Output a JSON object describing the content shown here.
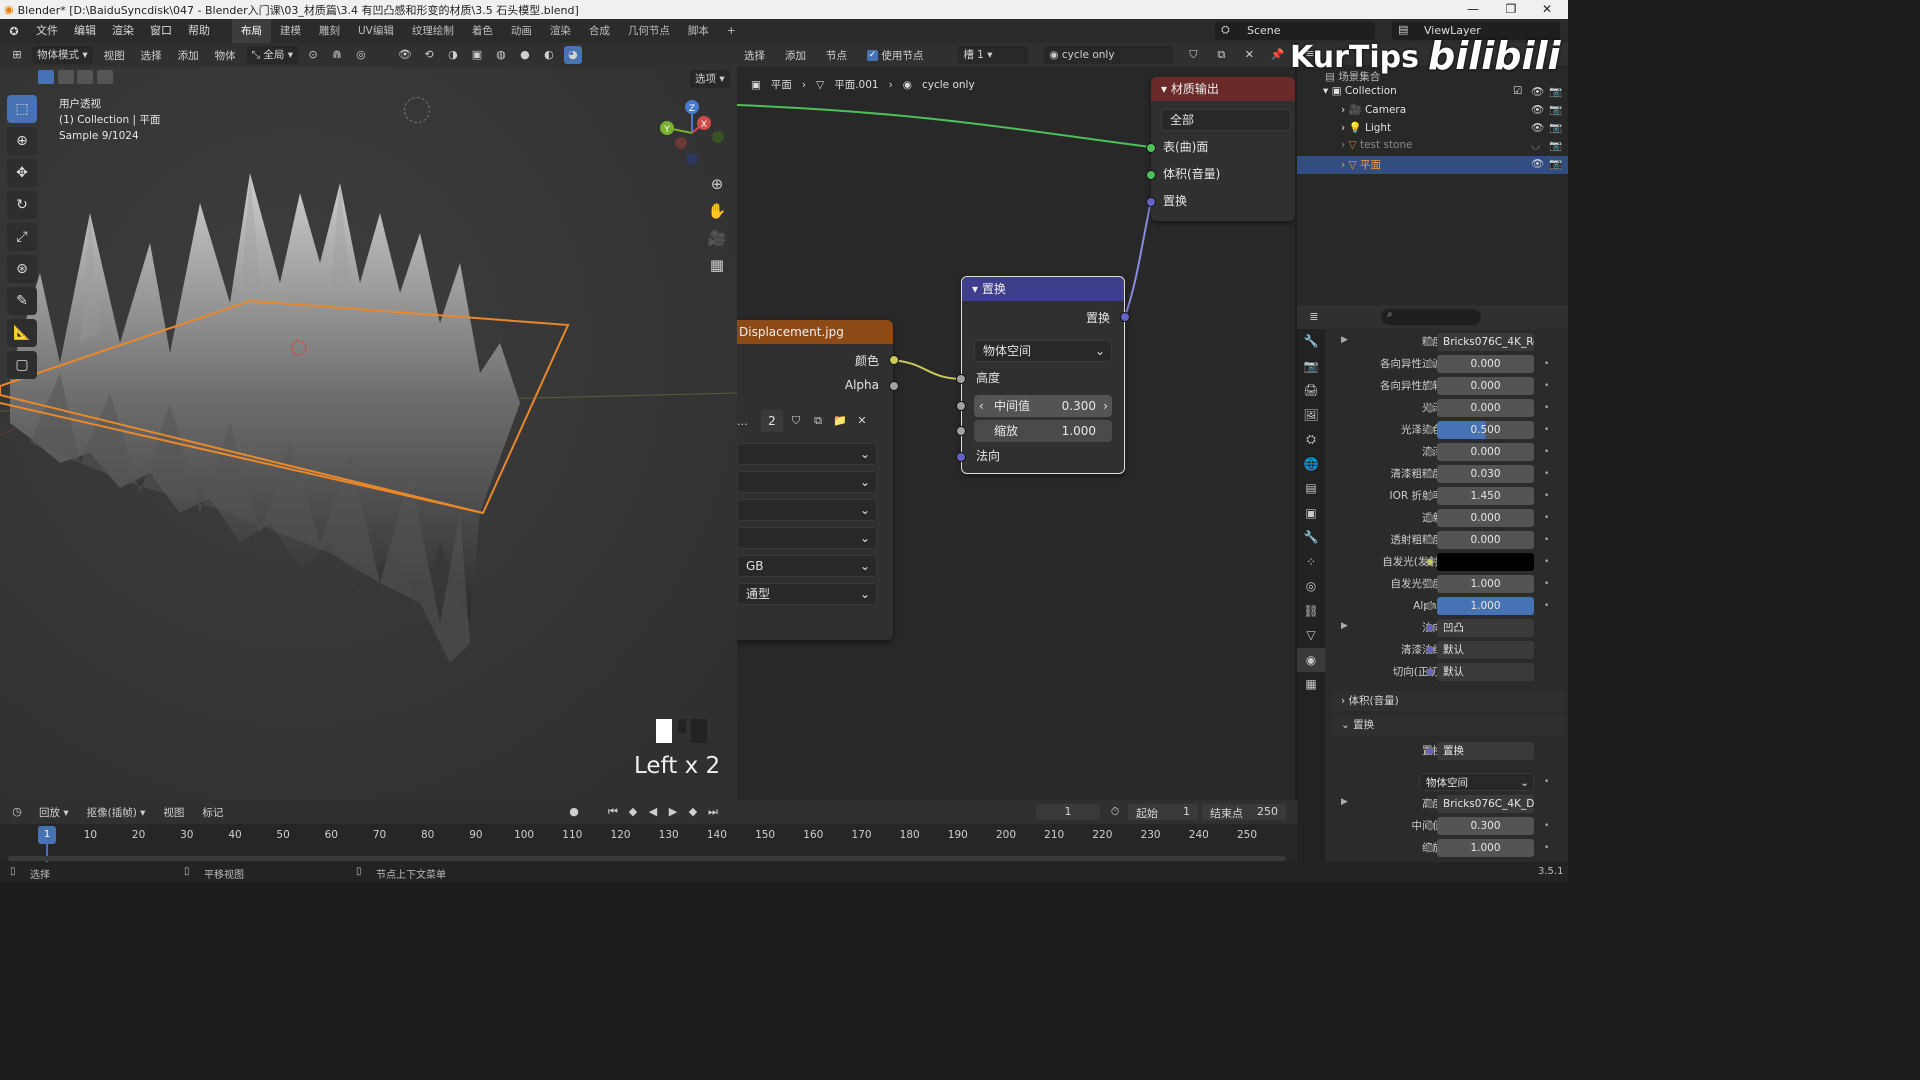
{
  "titlebar": {
    "title": "Blender* [D:\\BaiduSyncdisk\\047 - Blender入门课\\03_材质篇\\3.4 有凹凸感和形变的材质\\3.5 石头模型.blend]",
    "minimize": "—",
    "maximize": "❐",
    "close": "✕"
  },
  "menubar": {
    "menus": [
      "文件",
      "编辑",
      "渲染",
      "窗口",
      "帮助"
    ],
    "workspaces": [
      "布局",
      "建模",
      "雕刻",
      "UV编辑",
      "纹理绘制",
      "着色",
      "动画",
      "渲染",
      "合成",
      "几何节点",
      "脚本"
    ],
    "active_workspace": "布局",
    "add_tab": "+",
    "scene": "Scene",
    "view_layer": "ViewLayer"
  },
  "watermark": {
    "left": "KurTips",
    "right": "bilibili"
  },
  "viewport": {
    "mode": "物体模式",
    "menus": [
      "视图",
      "选择",
      "添加",
      "物体"
    ],
    "transform_orientation": "全局",
    "options": "选项",
    "info_line1": "用户透视",
    "info_line2": "(1) Collection | 平面",
    "info_line3": "Sample 9/1024",
    "gizmo": {
      "x": "X",
      "y": "Y",
      "z": "Z"
    },
    "key_overlay": "Left x 2"
  },
  "node_editor": {
    "menus": [
      "选择",
      "添加",
      "节点"
    ],
    "use_nodes_label": "使用节点",
    "slot": "槽 1",
    "material_name": "cycle only",
    "breadcrumb": [
      "平面",
      "平面.001",
      "cycle only"
    ],
    "output_node": {
      "title": "材质输出",
      "target": "全部",
      "inputs": [
        "表(曲)面",
        "体积(音量)",
        "置换"
      ]
    },
    "displacement_node": {
      "title": "置换",
      "output": "置换",
      "space": "物体空间",
      "inputs": {
        "height": "高度",
        "midlevel_label": "中间值",
        "midlevel_value": "0.300",
        "scale_label": "缩放",
        "scale_value": "1.000",
        "normal": "法向"
      }
    },
    "image_node": {
      "title": "Displacement.jpg",
      "outputs": [
        "颜色",
        "Alpha"
      ],
      "users": "2",
      "dropdown_rgb": "GB",
      "dropdown_type": "通型"
    }
  },
  "outliner": {
    "root": "场景集合",
    "collection": "Collection",
    "items": [
      {
        "name": "Camera",
        "color": "#e0a050"
      },
      {
        "name": "Light",
        "color": "#e0a050"
      },
      {
        "name": "test stone",
        "color": "#e0a050"
      },
      {
        "name": "平面",
        "color": "#e0a050"
      }
    ]
  },
  "properties": {
    "rows": [
      {
        "label": "糙度",
        "value": "Bricks076C_4K_Ro...",
        "kind": "link"
      },
      {
        "label": "各向异性过滤",
        "value": "0.000",
        "kind": "num"
      },
      {
        "label": "各向异性旋转",
        "value": "0.000",
        "kind": "num"
      },
      {
        "label": "光泽",
        "value": "0.000",
        "kind": "num"
      },
      {
        "label": "光泽染色",
        "value": "0.500",
        "kind": "fill",
        "fill": 0.5
      },
      {
        "label": "清漆",
        "value": "0.000",
        "kind": "num"
      },
      {
        "label": "清漆粗糙度",
        "value": "0.030",
        "kind": "num"
      },
      {
        "label": "IOR 折射率",
        "value": "1.450",
        "kind": "num"
      },
      {
        "label": "透射",
        "value": "0.000",
        "kind": "num"
      },
      {
        "label": "透射粗糙度",
        "value": "0.000",
        "kind": "num"
      },
      {
        "label": "自发光(发射)",
        "value": "",
        "kind": "color"
      },
      {
        "label": "自发光强度",
        "value": "1.000",
        "kind": "num"
      },
      {
        "label": "Alpha",
        "value": "1.000",
        "kind": "fill",
        "fill": 1.0
      },
      {
        "label": "法向",
        "value": "凹凸",
        "kind": "link"
      },
      {
        "label": "清漆法线",
        "value": "默认",
        "kind": "link"
      },
      {
        "label": "切向(正切)",
        "value": "默认",
        "kind": "link"
      }
    ],
    "section_volume": "体积(音量)",
    "section_displacement": "置换",
    "disp_rows": [
      {
        "label": "置换",
        "value": "置换",
        "kind": "link"
      },
      {
        "label": "",
        "value": "物体空间",
        "kind": "select"
      },
      {
        "label": "高度",
        "value": "Bricks076C_4K_Dis...",
        "kind": "link"
      },
      {
        "label": "中间值",
        "value": "0.300",
        "kind": "num"
      },
      {
        "label": "缩放",
        "value": "1.000",
        "kind": "num"
      }
    ]
  },
  "timeline": {
    "menus": [
      "回放",
      "抠像(插帧)",
      "视图",
      "标记"
    ],
    "current_frame": "1",
    "start_label": "起始",
    "start": "1",
    "end_label": "结束点",
    "end": "250",
    "ticks": [
      "1",
      "10",
      "20",
      "30",
      "40",
      "50",
      "60",
      "70",
      "80",
      "90",
      "100",
      "110",
      "120",
      "130",
      "140",
      "150",
      "160",
      "170",
      "180",
      "190",
      "200",
      "210",
      "220",
      "230",
      "240",
      "250"
    ]
  },
  "statusbar": {
    "select": "选择",
    "pan": "平移视图",
    "context": "节点上下文菜单",
    "version": "3.5.1"
  }
}
